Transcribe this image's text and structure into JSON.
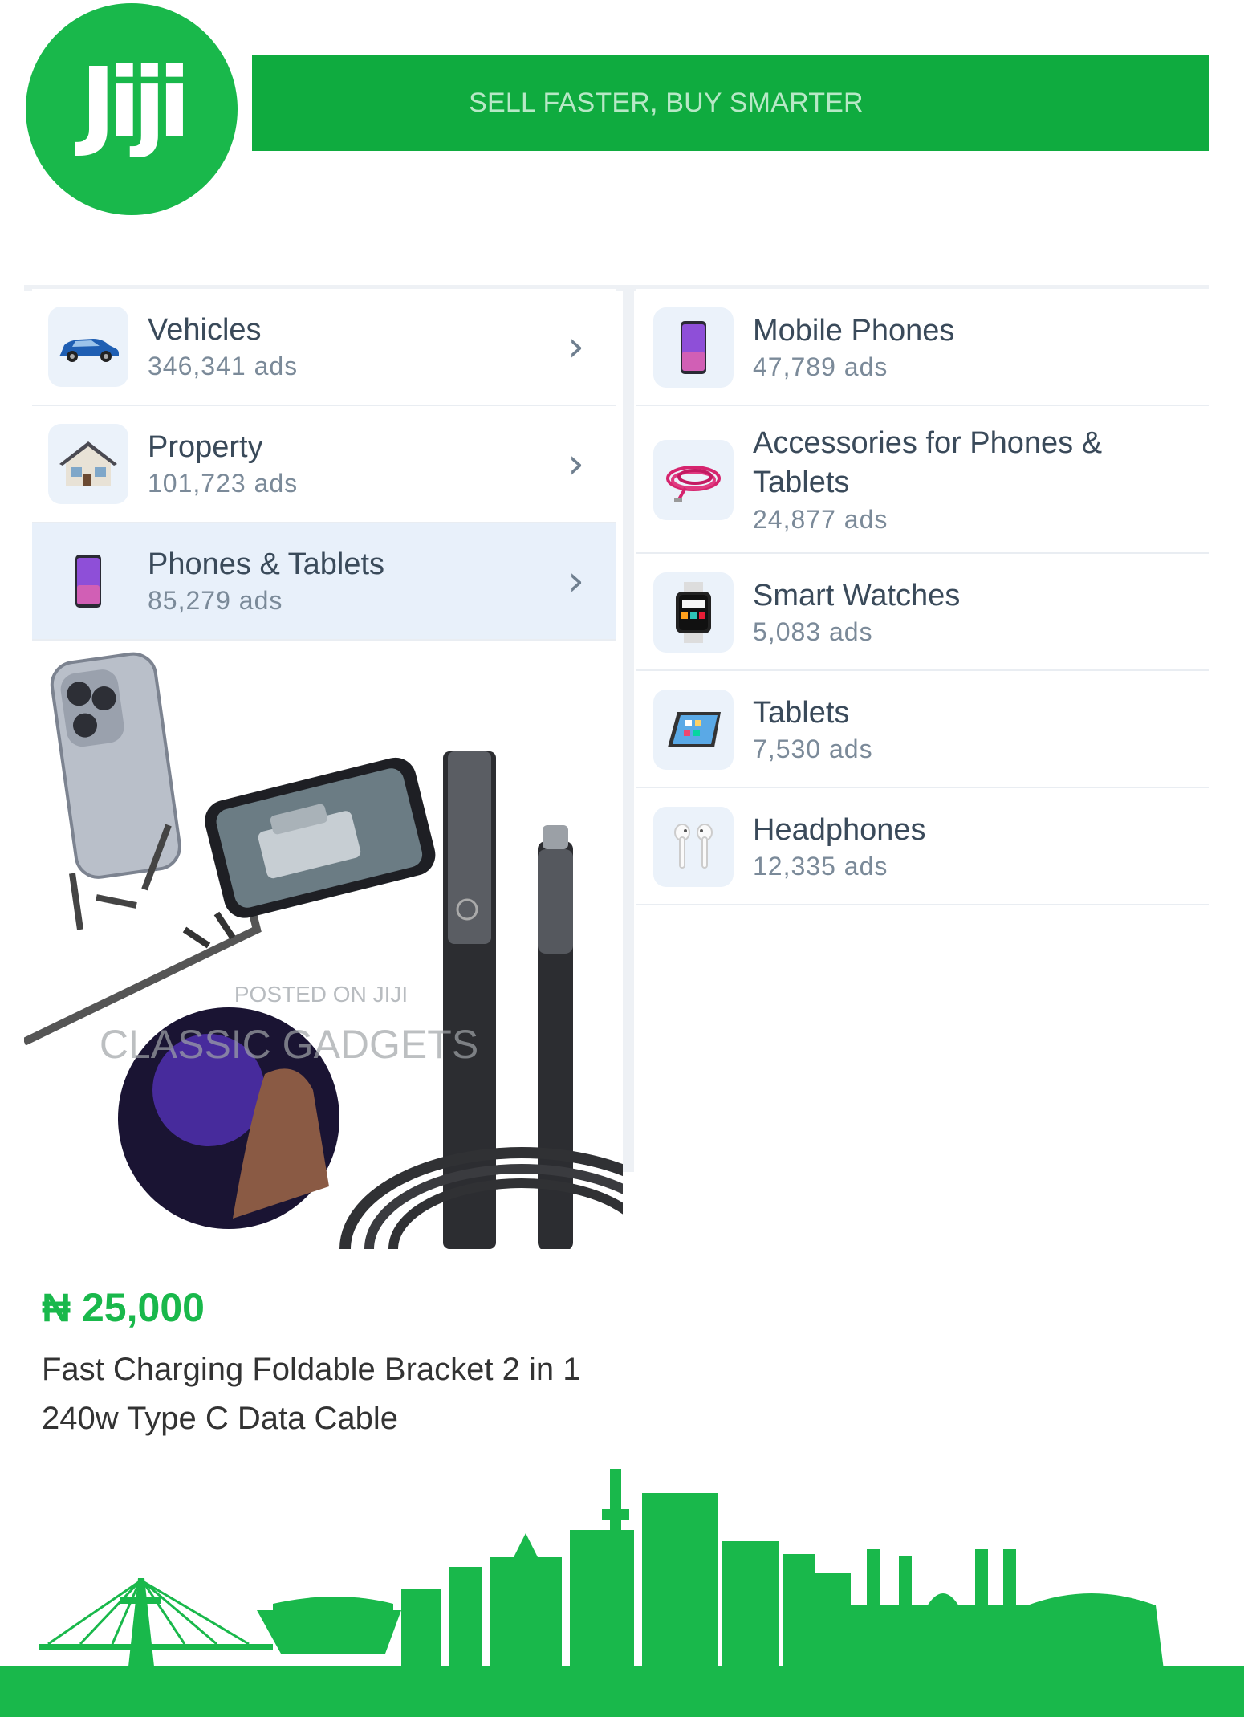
{
  "brand": {
    "logo_text": "Jiji",
    "tagline": "SELL FASTER, BUY SMARTER"
  },
  "colors": {
    "brand_green": "#19b84b",
    "banner_green": "#0fab3f",
    "active_row_bg": "#e8f0fa"
  },
  "categories": [
    {
      "name": "Vehicles",
      "count": "346,341 ads",
      "icon": "car-icon",
      "active": false
    },
    {
      "name": "Property",
      "count": "101,723 ads",
      "icon": "house-icon",
      "active": false
    },
    {
      "name": "Phones & Tablets",
      "count": "85,279 ads",
      "icon": "phone-icon",
      "active": true
    }
  ],
  "subcategories": [
    {
      "name": "Mobile Phones",
      "count": "47,789 ads",
      "icon": "phone-icon"
    },
    {
      "name": "Accessories for Phones & Tablets",
      "count": "24,877 ads",
      "icon": "cable-icon"
    },
    {
      "name": "Smart Watches",
      "count": "5,083 ads",
      "icon": "smartwatch-icon"
    },
    {
      "name": "Tablets",
      "count": "7,530 ads",
      "icon": "tablet-icon"
    },
    {
      "name": "Headphones",
      "count": "12,335 ads",
      "icon": "earbuds-icon"
    }
  ],
  "product": {
    "watermark_line1": "POSTED ON JIJI",
    "watermark_line2": "CLASSIC GADGETS",
    "price": "₦ 25,000",
    "title": "Fast Charging Foldable Bracket 2 in 1 240w Type C Data Cable"
  }
}
